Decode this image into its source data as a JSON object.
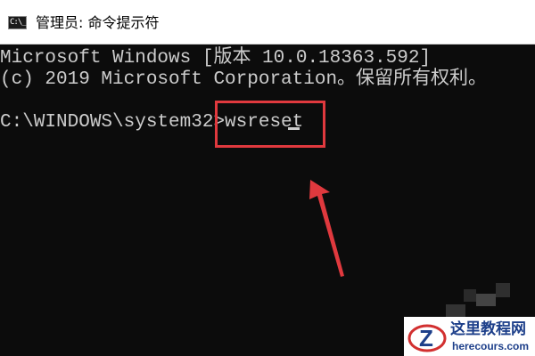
{
  "window": {
    "title": "管理员: 命令提示符",
    "icon": "cmd-icon",
    "icon_glyph": "C:\\_"
  },
  "console": {
    "lines": [
      "Microsoft Windows [版本 10.0.18363.592]",
      "(c) 2019 Microsoft Corporation。保留所有权利。",
      "",
      "C:\\WINDOWS\\system32>wsreset"
    ],
    "colors": {
      "background": "#0c0c0c",
      "text": "#cccccc",
      "highlight": "#e0393e"
    }
  },
  "annotation": {
    "highlight_target": "wsreset",
    "arrow": "red-arrow-up"
  },
  "watermark": {
    "title": "这里教程网",
    "url": "herecours.com",
    "logo_letter": "Z"
  }
}
